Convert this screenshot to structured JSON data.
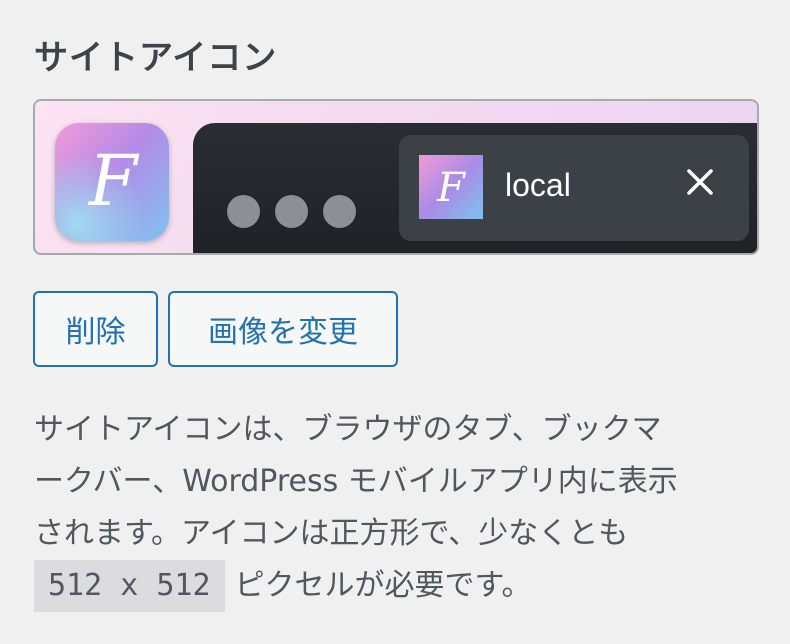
{
  "section": {
    "title": "サイトアイコン"
  },
  "preview": {
    "tab_label": "local",
    "icon_letter": "F"
  },
  "buttons": {
    "remove": "削除",
    "change": "画像を変更"
  },
  "description": {
    "line1": "サイトアイコンは、ブラウザのタブ、ブックマ",
    "line2": "ークバー、WordPress モバイルアプリ内に表示",
    "line3": "されます。アイコンは正方形で、少なくとも",
    "size_code": "512 x 512",
    "line4_suffix": "ピクセルが必要です。"
  },
  "colors": {
    "accent": "#2271b1",
    "text": "#50575e",
    "heading": "#3c434a",
    "background": "#f0f0f1"
  }
}
